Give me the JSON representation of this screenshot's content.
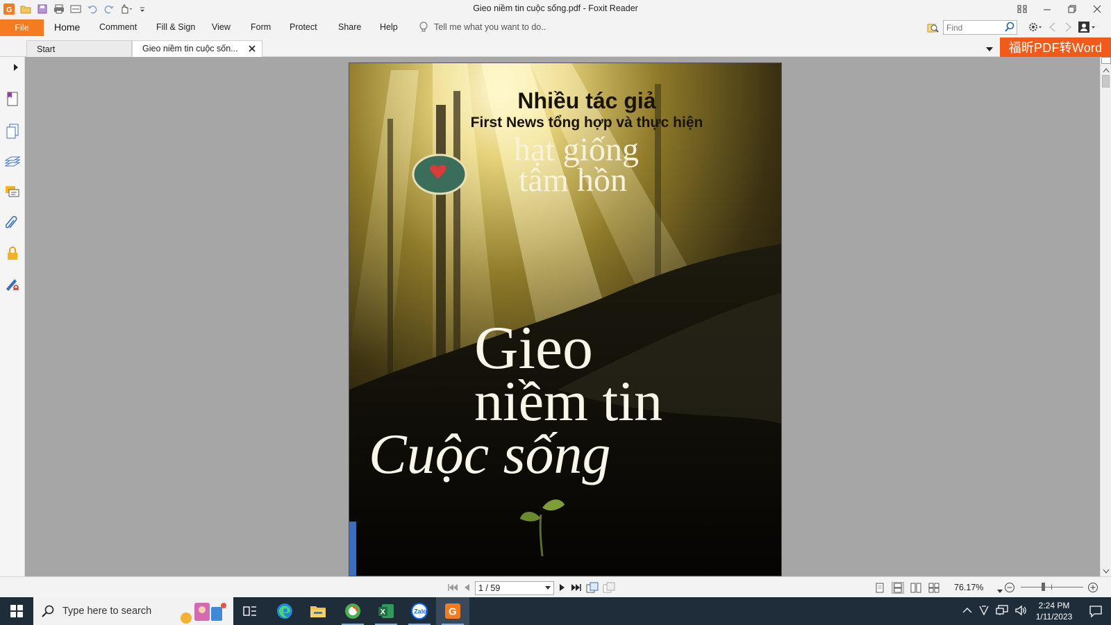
{
  "window": {
    "title": "Gieo niềm tin cuộc sống.pdf - Foxit Reader"
  },
  "menu": {
    "file": "File",
    "items": [
      "Home",
      "Comment",
      "Fill & Sign",
      "View",
      "Form",
      "Protect",
      "Share",
      "Help"
    ],
    "active": "Home",
    "tell_me": "Tell me what you want to do..",
    "find_placeholder": "Find"
  },
  "tabs": [
    {
      "label": "Start",
      "active": false
    },
    {
      "label": "Gieo niềm tin cuộc sốn...",
      "active": true
    }
  ],
  "promo": "福昕PDF转Word",
  "document": {
    "cover": {
      "author": "Nhiều tác giả",
      "publisher_line": "First News tổng hợp và thực hiện",
      "series_line1": "hạt giống",
      "series_line2": "tâm hồn",
      "title_line1": "Gieo",
      "title_line2": "niềm tin",
      "title_line3": "Cuộc sống"
    }
  },
  "status": {
    "page_indicator": "1 / 59",
    "zoom": "76.17%"
  },
  "taskbar": {
    "search_placeholder": "Type here to search",
    "apps": [
      "task-view",
      "edge",
      "file-explorer",
      "chrome-like",
      "excel",
      "zalo",
      "foxit-reader"
    ],
    "time": "2:24 PM",
    "date": "1/11/2023"
  },
  "colors": {
    "accent": "#f47b20",
    "promo": "#f25a1a",
    "doc_bg": "#a6a6a6",
    "taskbar": "#1f2c3a"
  }
}
